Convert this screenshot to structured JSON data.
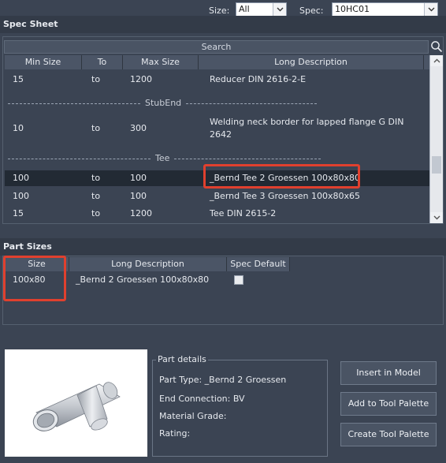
{
  "filters": {
    "size_label": "Size:",
    "size_value": "All",
    "spec_label": "Spec:",
    "spec_value": "10HC01"
  },
  "spec_sheet": {
    "title": "Spec Sheet",
    "search_label": "Search",
    "columns": [
      "Min Size",
      "To",
      "Max Size",
      "Long Description"
    ],
    "rows": [
      {
        "min": "15",
        "to": "to",
        "max": "1200",
        "desc": "Reducer DIN 2616-2-E"
      },
      {
        "min": "10",
        "to": "to",
        "max": "300",
        "desc": "Welding neck border for lapped flange G DIN",
        "desc2": "2642"
      },
      {
        "min": "100",
        "to": "to",
        "max": "100",
        "desc": "_Bernd Tee 2 Groessen 100x80x80"
      },
      {
        "min": "100",
        "to": "to",
        "max": "100",
        "desc": "_Bernd Tee 3 Groessen 100x80x65"
      },
      {
        "min": "15",
        "to": "to",
        "max": "1200",
        "desc": "Tee DIN 2615-2"
      }
    ],
    "groups": [
      "StubEnd",
      "Tee"
    ]
  },
  "part_sizes": {
    "title": "Part Sizes",
    "columns": [
      "Size",
      "Long Description",
      "Spec Default"
    ],
    "rows": [
      {
        "size": "100x80",
        "desc": "_Bernd 2 Groessen 100x80x80",
        "spec_default": false
      }
    ]
  },
  "part_details": {
    "title": "Part details",
    "part_type": "Part Type: _Bernd 2 Groessen",
    "end_connection": "End Connection: BV",
    "material_grade": "Material Grade:",
    "rating": "Rating:"
  },
  "actions": {
    "insert": "Insert in Model",
    "add_palette": "Add to Tool Palette",
    "create_palette": "Create Tool Palette"
  },
  "icons": {
    "search": "search-icon",
    "dropdown": "chevron-down-icon"
  },
  "colors": {
    "background": "#3b4453",
    "highlight": "#e0402e",
    "selected_row": "#222a34"
  }
}
